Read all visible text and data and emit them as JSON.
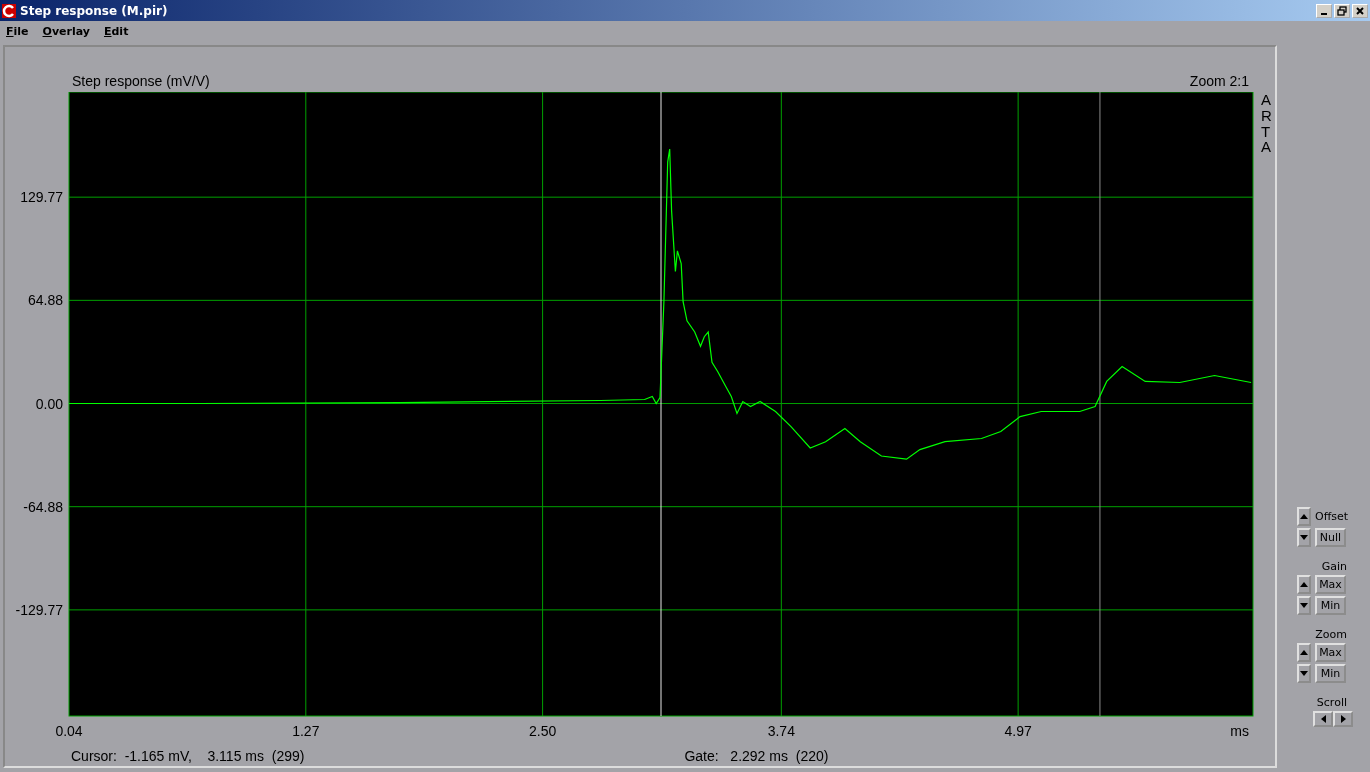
{
  "window": {
    "title": "Step response (M.pir)"
  },
  "menu": [
    "File",
    "Overlay",
    "Edit"
  ],
  "plot": {
    "zoom_label": "Zoom 2:1",
    "brand": "ARTA",
    "chart_data": {
      "type": "line",
      "title": "Step response (mV/V)",
      "xlabel": "ms",
      "xlim": [
        0.04,
        6.19
      ],
      "ylim": [
        -196.5,
        195.9
      ],
      "xticks": [
        {
          "value": 0.04,
          "label": "0.04"
        },
        {
          "value": 1.27,
          "label": "1.27"
        },
        {
          "value": 2.5,
          "label": "2.50"
        },
        {
          "value": 3.74,
          "label": "3.74"
        },
        {
          "value": 4.97,
          "label": "4.97"
        }
      ],
      "yticks": [
        {
          "value": -129.77,
          "label": "-129.77"
        },
        {
          "value": -64.88,
          "label": "-64.88"
        },
        {
          "value": 0,
          "label": "0.00"
        },
        {
          "value": 64.88,
          "label": "64.88"
        },
        {
          "value": 129.77,
          "label": "129.77"
        }
      ],
      "x": [
        0.04,
        0.72,
        1.76,
        2.8,
        3.03,
        3.07,
        3.09,
        3.11,
        3.13,
        3.15,
        3.16,
        3.17,
        3.19,
        3.2,
        3.22,
        3.23,
        3.25,
        3.29,
        3.32,
        3.34,
        3.36,
        3.38,
        3.41,
        3.45,
        3.48,
        3.51,
        3.54,
        3.58,
        3.63,
        3.71,
        3.79,
        3.89,
        3.97,
        4.07,
        4.15,
        4.26,
        4.39,
        4.46,
        4.59,
        4.78,
        4.88,
        4.98,
        5.09,
        5.29,
        5.37,
        5.43,
        5.51,
        5.63,
        5.81,
        5.99,
        6.18
      ],
      "grid": true,
      "series": [
        {
          "color": "#00ff00",
          "values": [
            0,
            0,
            0.6,
            1.9,
            2.5,
            4.4,
            0,
            3.8,
            64,
            152,
            160,
            121,
            83,
            96,
            88,
            64,
            52,
            45,
            36,
            42,
            45,
            26,
            20,
            11,
            4.4,
            -6.3,
            1.3,
            -1.9,
            1.3,
            -5,
            -14.5,
            -28,
            -24,
            -15.7,
            -24,
            -33,
            -35,
            -29,
            -24,
            -22,
            -17.6,
            -8.2,
            -5,
            -5,
            -1.9,
            13.9,
            23.3,
            13.9,
            13.2,
            17.6,
            13.2
          ]
        }
      ],
      "ref_lines": [
        {
          "axis": "x",
          "value": 3.115,
          "color": "#e8e8e8"
        },
        {
          "axis": "x",
          "value": 5.395,
          "color": "#8c8c8c"
        }
      ]
    }
  },
  "status_bar": {
    "cursor": "Cursor:  -1.165 mV,    3.115 ms  (299)",
    "gate": "Gate:   2.292 ms  (220)"
  },
  "controls": [
    {
      "kind": "offset",
      "label": "Offset",
      "buttons": [
        "Null"
      ]
    },
    {
      "kind": "pair",
      "label": "Gain",
      "buttons": [
        "Max",
        "Min"
      ]
    },
    {
      "kind": "pair",
      "label": "Zoom",
      "buttons": [
        "Max",
        "Min"
      ]
    },
    {
      "kind": "scroll",
      "label": "Scroll"
    }
  ]
}
